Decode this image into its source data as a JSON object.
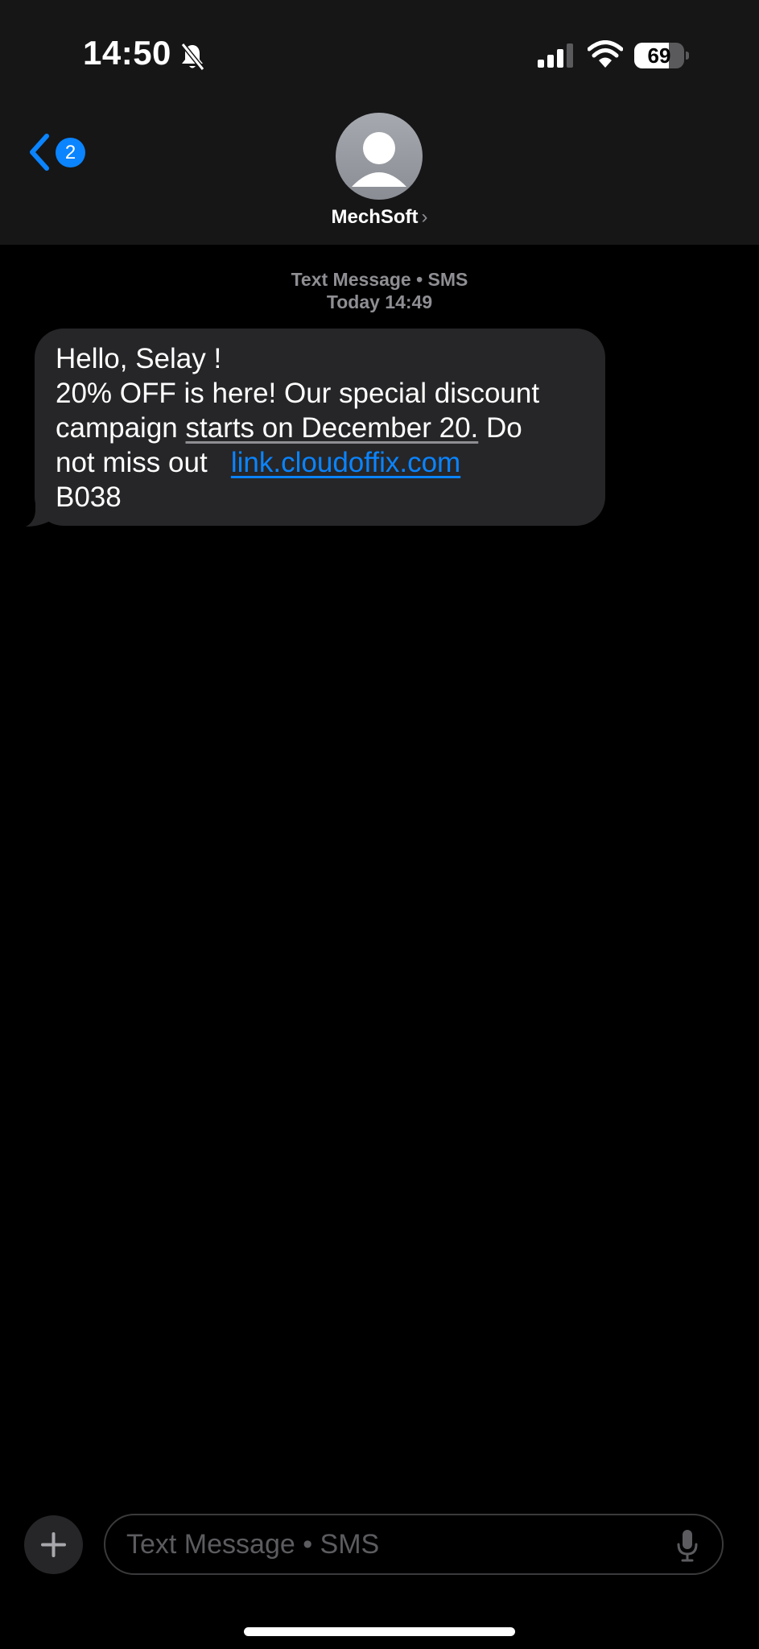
{
  "status_bar": {
    "time": "14:50",
    "battery_level": "69",
    "icons": [
      "bell-slash-icon",
      "cellular-signal-icon",
      "wifi-icon",
      "battery-icon"
    ]
  },
  "nav": {
    "back_badge_count": "2",
    "contact_name": "MechSoft",
    "chevron": "›"
  },
  "thread": {
    "service_label": "Text Message • SMS",
    "timestamp": "Today 14:49"
  },
  "message": {
    "line1": "Hello, Selay !",
    "line2": "20% OFF is here! Our special discount",
    "line3_pre": "campaign ",
    "line3_date": "starts on December 20.",
    "line3_post": " Do",
    "line4_pre": "not miss out ",
    "link": "link.cloudoffix.com",
    "line5": "B038"
  },
  "composer": {
    "placeholder": "Text Message • SMS"
  },
  "colors": {
    "accent": "#0a84ff",
    "bubble": "#262628",
    "header_bg": "#161617",
    "background": "#000000",
    "secondary_text": "#8e8e93"
  }
}
